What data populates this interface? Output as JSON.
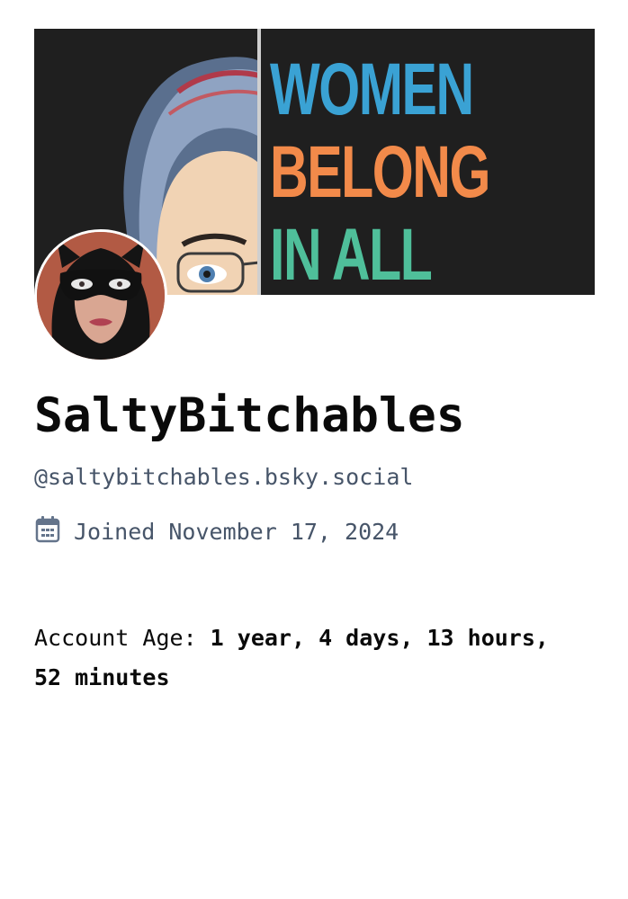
{
  "banner": {
    "lines": [
      {
        "text": "WOMEN",
        "color": "#3aa2d4"
      },
      {
        "text": "BELONG",
        "color": "#f28a4a"
      },
      {
        "text": "IN ALL",
        "color": "#4fbf9a"
      }
    ]
  },
  "profile": {
    "display_name": "SaltyBitchables",
    "handle": "@saltybitchables.bsky.social",
    "joined_text": "Joined November 17, 2024",
    "joined_icon": "calendar-icon"
  },
  "account_age": {
    "label": "Account Age: ",
    "value": "1 year, 4 days, 13 hours, 52 minutes"
  },
  "colors": {
    "muted_text": "#475569",
    "primary_text": "#0a0a0a",
    "banner_bg": "#1f1f1f"
  }
}
